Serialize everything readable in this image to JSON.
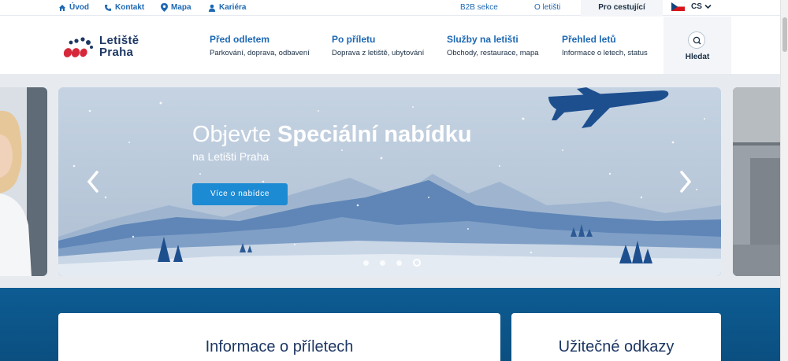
{
  "topbar": {
    "links": [
      {
        "label": "Úvod",
        "icon": "home-icon"
      },
      {
        "label": "Kontakt",
        "icon": "phone-icon"
      },
      {
        "label": "Mapa",
        "icon": "map-pin-icon"
      },
      {
        "label": "Kariéra",
        "icon": "person-icon"
      }
    ],
    "b2b": "B2B sekce",
    "about": "O letišti",
    "travelers": "Pro cestující",
    "lang": "CS"
  },
  "logo": {
    "line1": "Letiště",
    "line2": "Praha"
  },
  "nav": [
    {
      "title": "Před odletem",
      "sub": "Parkování, doprava, odbavení"
    },
    {
      "title": "Po příletu",
      "sub": "Doprava z letiště, ubytování"
    },
    {
      "title": "Služby na letišti",
      "sub": "Obchody, restaurace, mapa"
    },
    {
      "title": "Přehled letů",
      "sub": "Informace o letech, status"
    }
  ],
  "search": {
    "label": "Hledat"
  },
  "hero": {
    "headline_light": "Objevte",
    "headline_bold": "Speciální nabídku",
    "subline": "na Letišti Praha",
    "cta": "Více o nabídce",
    "dots_count": 4,
    "active_dot": 4
  },
  "cards": {
    "arrivals": "Informace o příletech",
    "links": "Užitečné odkazy"
  },
  "colors": {
    "accent": "#1d68b3",
    "cta": "#1d8bd4",
    "band": "#0d5c93",
    "logo_red": "#d6283a"
  }
}
